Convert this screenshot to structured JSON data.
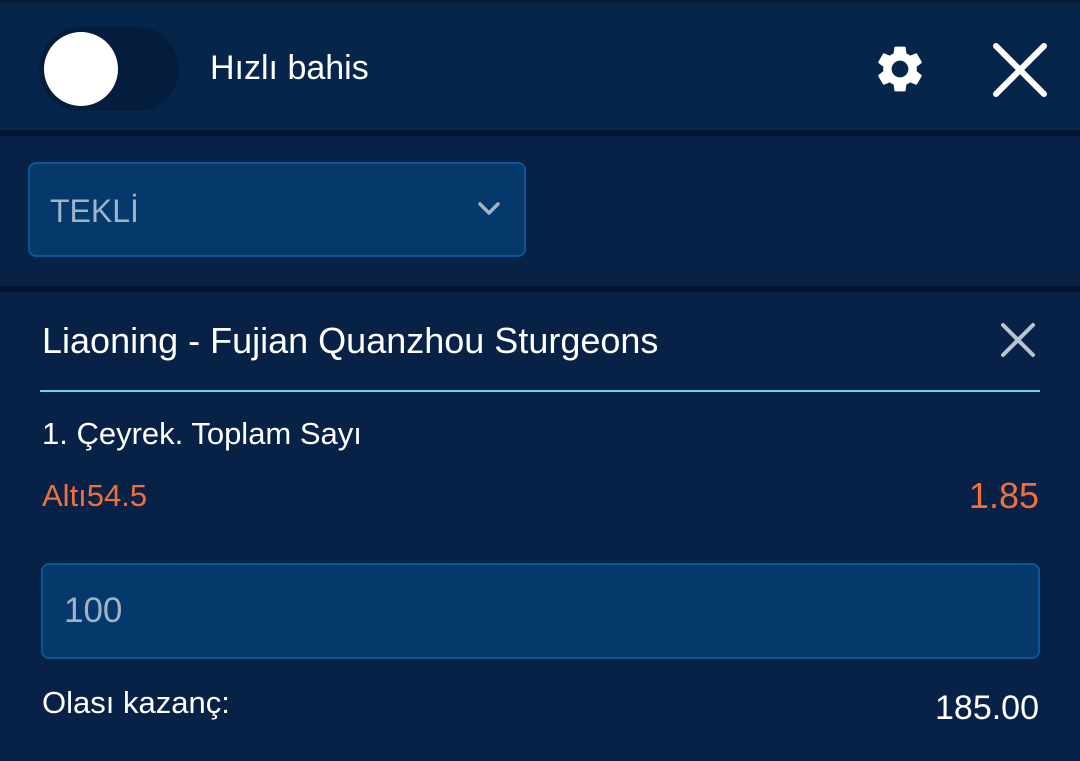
{
  "header": {
    "quick_bet_label": "Hızlı bahis",
    "quick_bet_enabled": false,
    "settings_icon": "gear-icon",
    "close_icon": "close-icon"
  },
  "bet_type": {
    "selected": "TEKLİ",
    "icon": "chevron-down-icon"
  },
  "bet": {
    "match": "Liaoning - Fujian Quanzhou Sturgeons",
    "market": "1. Çeyrek. Toplam Sayı",
    "selection": "Altı54.5",
    "odds": "1.85",
    "stake_placeholder": "100",
    "potential_win_label": "Olası kazanç:",
    "potential_win_value": "185.00",
    "remove_icon": "close-icon"
  },
  "colors": {
    "background": "#072246",
    "input": "#06396b",
    "accent_line": "#6fd0ee",
    "odds": "#f0703a",
    "text": "#ffffff",
    "muted_text": "#9fb3c9"
  }
}
